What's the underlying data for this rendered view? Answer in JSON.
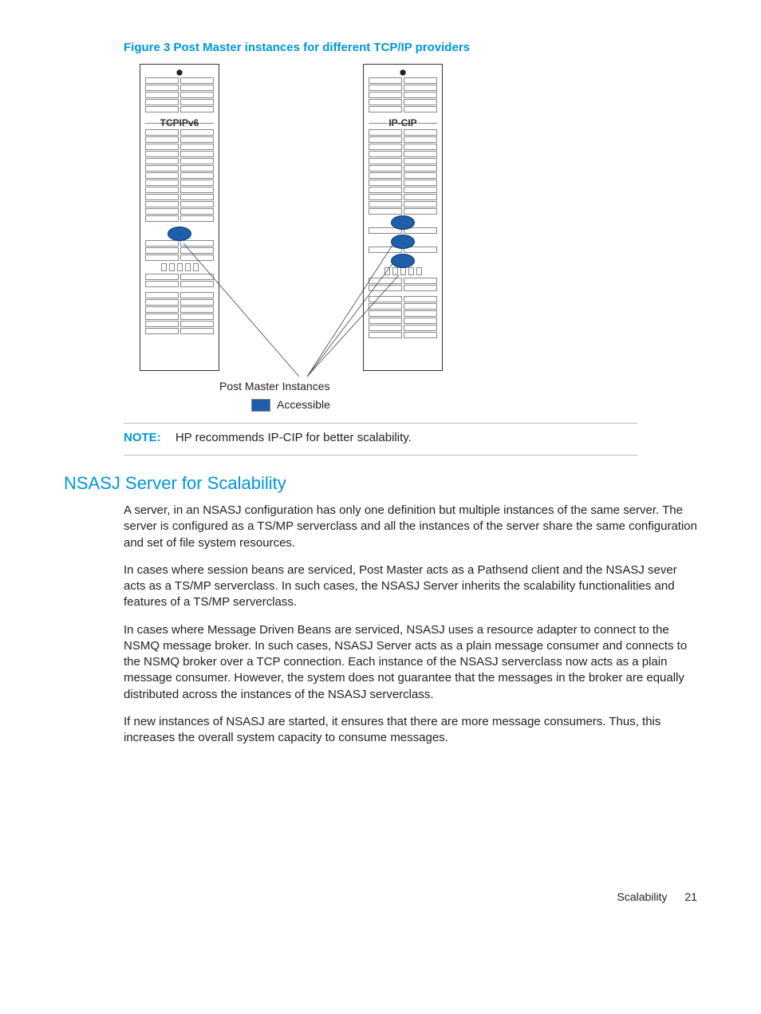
{
  "figure": {
    "caption": "Figure 3 Post Master instances for different TCP/IP providers",
    "left_rack_label": "TCPIPv6",
    "right_rack_label": "IP-CIP",
    "pm_label": "Post Master Instances",
    "legend_label": "Accessible"
  },
  "note": {
    "label": "NOTE:",
    "text": "HP recommends IP-CIP for better scalability."
  },
  "section": {
    "title": "NSASJ Server for Scalability",
    "p1": "A server, in an NSASJ configuration has only one definition but multiple instances of the same server. The server is configured as a TS/MP serverclass and all the instances of the server share the same configuration and set of file system resources.",
    "p2": "In cases where session beans are serviced, Post Master acts as a Pathsend client and the NSASJ sever acts as a TS/MP serverclass. In such cases, the NSASJ Server inherits the scalability functionalities and features of a TS/MP serverclass.",
    "p3": "In cases where Message Driven Beans are serviced, NSASJ uses a resource adapter to connect to the NSMQ message broker. In such cases, NSASJ Server acts as a plain message consumer and connects to the NSMQ broker over a TCP connection. Each instance of the NSASJ serverclass now acts as a plain message consumer. However, the system does not guarantee that the messages in the broker are equally distributed across the instances of the NSASJ serverclass.",
    "p4": "If new instances of NSASJ are started, it ensures that there are more message consumers. Thus, this increases the overall system capacity to consume messages."
  },
  "footer": {
    "label": "Scalability",
    "page": "21"
  }
}
